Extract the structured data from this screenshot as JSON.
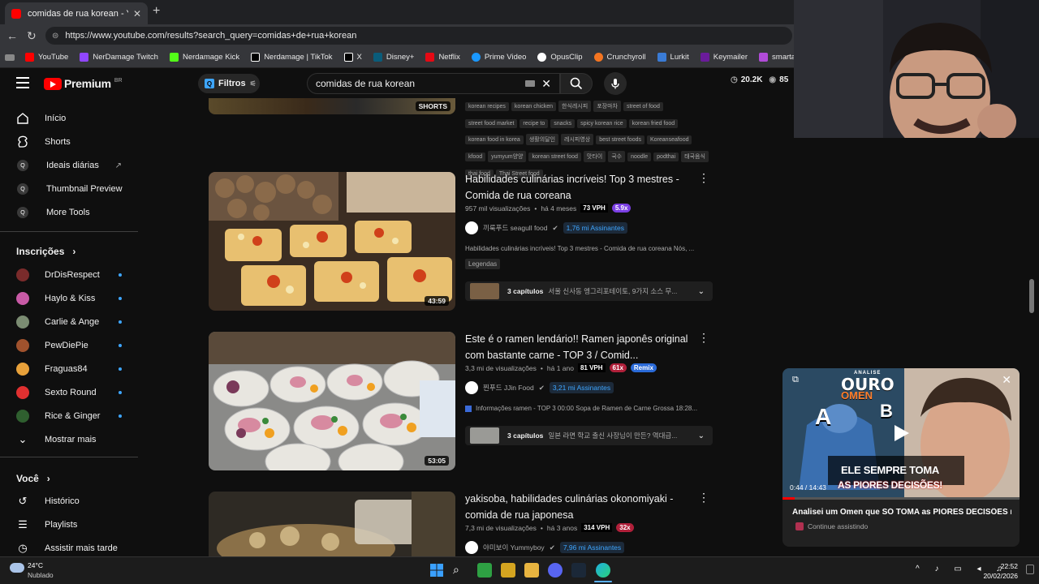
{
  "browser": {
    "tab_title": "comidas de rua korean - YouTube",
    "url": "https://www.youtube.com/results?search_query=comidas+de+rua+korean",
    "bookmarks": [
      "YouTube",
      "NerDamage Twitch",
      "Nerdamage Kick",
      "Nerdamage | TikTok",
      "X",
      "Disney+",
      "Netflix",
      "Prime Video",
      "OpusClip",
      "Crunchyroll",
      "Lurkit",
      "Keymailer",
      "smarta"
    ]
  },
  "header": {
    "logo": "Premium",
    "region": "BR",
    "filters_label": "Filtros",
    "search_value": "comidas de rua korean",
    "stat_views": "20.2K",
    "stat_count": "85"
  },
  "sidebar": {
    "main": [
      "Início",
      "Shorts",
      "Ideais diárias",
      "Thumbnail Preview",
      "More Tools"
    ],
    "subs_header": "Inscrições",
    "subs": [
      "DrDisRespect",
      "Haylo & Kiss",
      "Carlie & Ange",
      "PewDiePie",
      "Fraguas84",
      "Sexto Round",
      "Rice & Ginger"
    ],
    "show_more": "Mostrar mais",
    "you_header": "Você",
    "you": [
      "Histórico",
      "Playlists",
      "Assistir mais tarde"
    ]
  },
  "top": {
    "shorts_label": "SHORTS",
    "tags": [
      "korean recipes",
      "korean chicken",
      "한식레시피",
      "포장마차",
      "street of food",
      "street food market",
      "recipe to",
      "snacks",
      "spicy korean rice",
      "korean fried food",
      "korean food in korea",
      "생활의달인",
      "레시피영상",
      "best street foods",
      "Koreanseafood",
      "kfood",
      "yumyum양양",
      "korean street food",
      "맛타이",
      "국수",
      "noodle",
      "podthai",
      "태국음식",
      "thai food",
      "Thai Street food"
    ]
  },
  "videos": [
    {
      "title": "Habilidades culinárias incríveis! Top 3 mestres - Comida de rua coreana",
      "views": "957 mil visualizações",
      "age": "há 4 meses",
      "vph": "73 VPH",
      "mult": "5.9x",
      "channel": "끼룩푸드 seagull food",
      "subs": "1,76 mi Assinantes",
      "desc": "Habilidades culinárias incríveis! Top 3 mestres - Comida de rua coreana Nós, ...",
      "badge": "Legendas",
      "chapters": "3 capítulos",
      "chapter_text": "서울 신사동 엥그리포테이토, 9가지 소스 무...",
      "duration": "43:59"
    },
    {
      "title": "Este é o ramen lendário!! Ramen japonês original com bastante carne - TOP 3 / Comid...",
      "views": "3,3 mi de visualizações",
      "age": "há 1 ano",
      "vph": "81 VPH",
      "mult": "61x",
      "remix": "Remix",
      "channel": "찐푸드 JJin Food",
      "subs": "3,21 mi Assinantes",
      "desc": "Informações ramen - TOP 3 00:00 Sopa de Ramen de Carne Grossa 18:28...",
      "chapters": "3 capítulos",
      "chapter_text": "일본 라면 학교 출신 사장님이 만든? 역대급...",
      "duration": "53:05"
    },
    {
      "title": "yakisoba, habilidades culinárias okonomiyaki - comida de rua japonesa",
      "views": "7,3 mi de visualizações",
      "age": "há 3 anos",
      "vph": "314 VPH",
      "mult": "32x",
      "channel": "야미보이 Yummyboy",
      "subs": "7,96 mi Assinantes"
    }
  ],
  "miniplayer": {
    "overlay_top": "ANALISE",
    "overlay_big1": "OURO",
    "overlay_big2": "OMEN",
    "letter_a": "A",
    "letter_b": "B",
    "banner1": "ELE SEMPRE TOMA",
    "banner2": "AS PIORES DECISÕES!",
    "time": "0:44 / 14:43",
    "title": "Analisei um Omen que SÓ TOMA as PIORES DECISÕES n...",
    "continue": "Continue assistindo"
  },
  "taskbar": {
    "temp": "24°C",
    "weather": "Nublado",
    "time": "22:52",
    "date": "20/02/2026"
  }
}
